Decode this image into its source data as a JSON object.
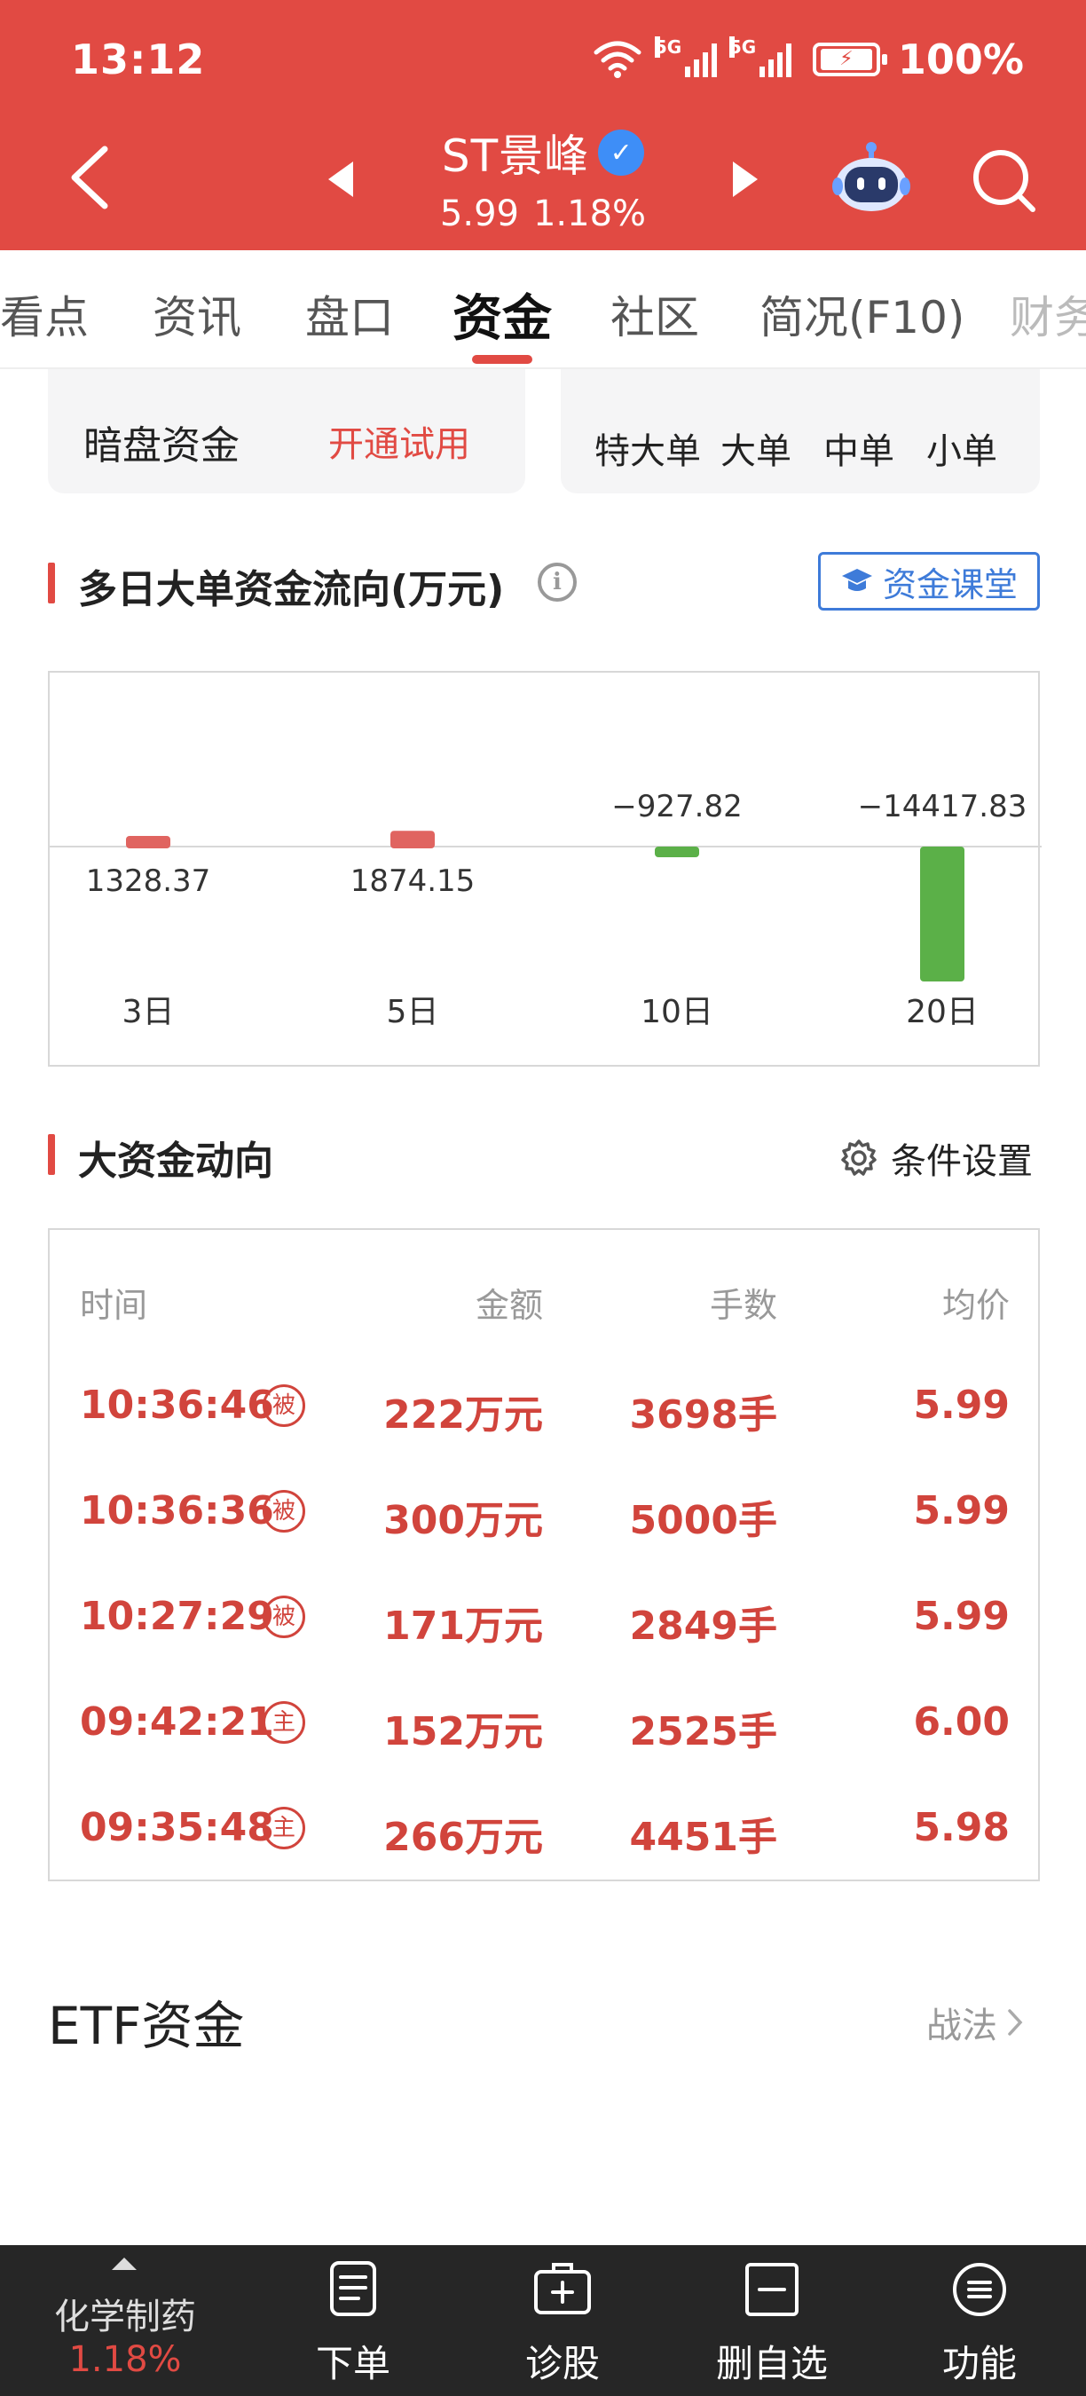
{
  "status_bar": {
    "time": "13:12",
    "signal1": "5G",
    "signal2": "5G",
    "battery": "100%"
  },
  "header": {
    "stock_name": "ST景峰",
    "price": "5.99",
    "change": "1.18%"
  },
  "tabs": [
    "看点",
    "资讯",
    "盘口",
    "资金",
    "社区",
    "简况(F10)",
    "财务"
  ],
  "active_tab": "资金",
  "dark_pool": {
    "title": "暗盘资金",
    "action": "开通试用"
  },
  "order_sizes": [
    "特大单",
    "大单",
    "中单",
    "小单"
  ],
  "multi_day": {
    "title": "多日大单资金流向(万元)",
    "class_button": "资金课堂"
  },
  "chart_data": {
    "type": "bar",
    "categories": [
      "3日",
      "5日",
      "10日",
      "20日"
    ],
    "values": [
      1328.37,
      1874.15,
      -927.82,
      -14417.83
    ],
    "labels": [
      "1328.37",
      "1874.15",
      "−927.82",
      "−14417.83"
    ],
    "colors": {
      "positive": "#e06460",
      "negative": "#5bb048"
    }
  },
  "big_funds": {
    "title": "大资金动向",
    "settings": "条件设置",
    "headers": {
      "time": "时间",
      "amount": "金额",
      "lots": "手数",
      "price": "均价"
    },
    "rows": [
      {
        "time": "10:36:46",
        "type": "被",
        "amount": "222万元",
        "lots": "3698手",
        "price": "5.99"
      },
      {
        "time": "10:36:36",
        "type": "被",
        "amount": "300万元",
        "lots": "5000手",
        "price": "5.99"
      },
      {
        "time": "10:27:29",
        "type": "被",
        "amount": "171万元",
        "lots": "2849手",
        "price": "5.99"
      },
      {
        "time": "09:42:21",
        "type": "主",
        "amount": "152万元",
        "lots": "2525手",
        "price": "6.00"
      },
      {
        "time": "09:35:48",
        "type": "主",
        "amount": "266万元",
        "lots": "4451手",
        "price": "5.98"
      }
    ]
  },
  "etf": {
    "title": "ETF资金",
    "link": "战法"
  },
  "bottom_bar": {
    "sector_name": "化学制药",
    "sector_change": "1.18%",
    "items": [
      {
        "label": "下单",
        "icon": "order-icon"
      },
      {
        "label": "诊股",
        "icon": "diagnose-icon"
      },
      {
        "label": "删自选",
        "icon": "remove-watchlist-icon"
      },
      {
        "label": "功能",
        "icon": "menu-icon"
      }
    ]
  },
  "colors": {
    "brand_red": "#e14a43",
    "rise_red": "#d1443c",
    "fall_green": "#5bb048",
    "link_blue": "#3e7bd9"
  }
}
